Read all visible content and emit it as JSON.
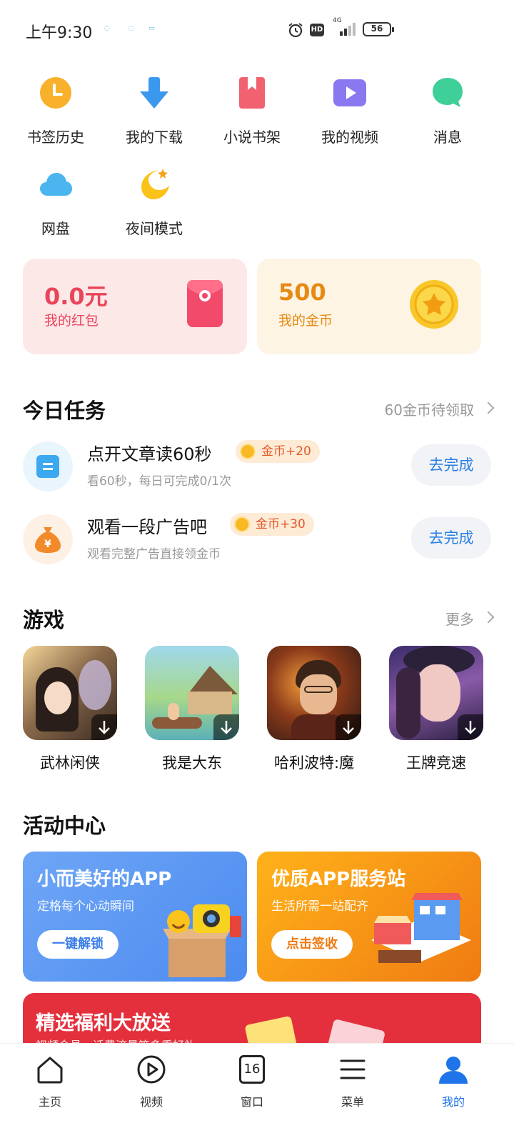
{
  "status": {
    "time": "上午9:30",
    "network": "4G",
    "battery": "56",
    "hd": "HD"
  },
  "shortcuts": [
    {
      "label": "书签历史",
      "icon": "clock-icon"
    },
    {
      "label": "我的下载",
      "icon": "download-icon"
    },
    {
      "label": "小说书架",
      "icon": "bookmark-icon"
    },
    {
      "label": "我的视频",
      "icon": "video-icon"
    },
    {
      "label": "消息",
      "icon": "chat-bubble-icon"
    },
    {
      "label": "网盘",
      "icon": "cloud-icon"
    },
    {
      "label": "夜间模式",
      "icon": "moon-icon"
    }
  ],
  "wallet": {
    "red_packet": {
      "value": "0.0元",
      "label": "我的红包",
      "color": "#e8455a"
    },
    "coins": {
      "value": "500",
      "label": "我的金币",
      "color": "#e58a14"
    }
  },
  "tasks": {
    "title": "今日任务",
    "more": "60金币待领取",
    "items": [
      {
        "title": "点开文章读60秒",
        "badge": "金币+20",
        "sub": "看60秒，每日可完成0/1次",
        "button": "去完成"
      },
      {
        "title": "观看一段广告吧",
        "badge": "金币+30",
        "sub": "观看完整广告直接领金币",
        "button": "去完成"
      }
    ]
  },
  "games": {
    "title": "游戏",
    "more": "更多",
    "items": [
      {
        "name": "武林闲侠"
      },
      {
        "name": "我是大东"
      },
      {
        "name": "哈利波特:魔"
      },
      {
        "name": "王牌竞速"
      }
    ]
  },
  "activities": {
    "title": "活动中心",
    "cards": [
      {
        "title": "小而美好的APP",
        "sub": "定格每个心动瞬间",
        "button": "一键解锁",
        "accent": "#4c8bf0"
      },
      {
        "title": "优质APP服务站",
        "sub": "生活所需一站配齐",
        "button": "点击签收",
        "accent": "#f07b12"
      }
    ],
    "banner": {
      "title": "精选福利大放送",
      "sub": "视频会员、话费流量等多重好礼"
    }
  },
  "tabbar": [
    {
      "label": "主页",
      "icon": "home-icon"
    },
    {
      "label": "视频",
      "icon": "play-icon"
    },
    {
      "label": "窗口",
      "icon": "window-count-icon",
      "count": "16"
    },
    {
      "label": "菜单",
      "icon": "menu-icon"
    },
    {
      "label": "我的",
      "icon": "person-icon",
      "active": true
    }
  ]
}
